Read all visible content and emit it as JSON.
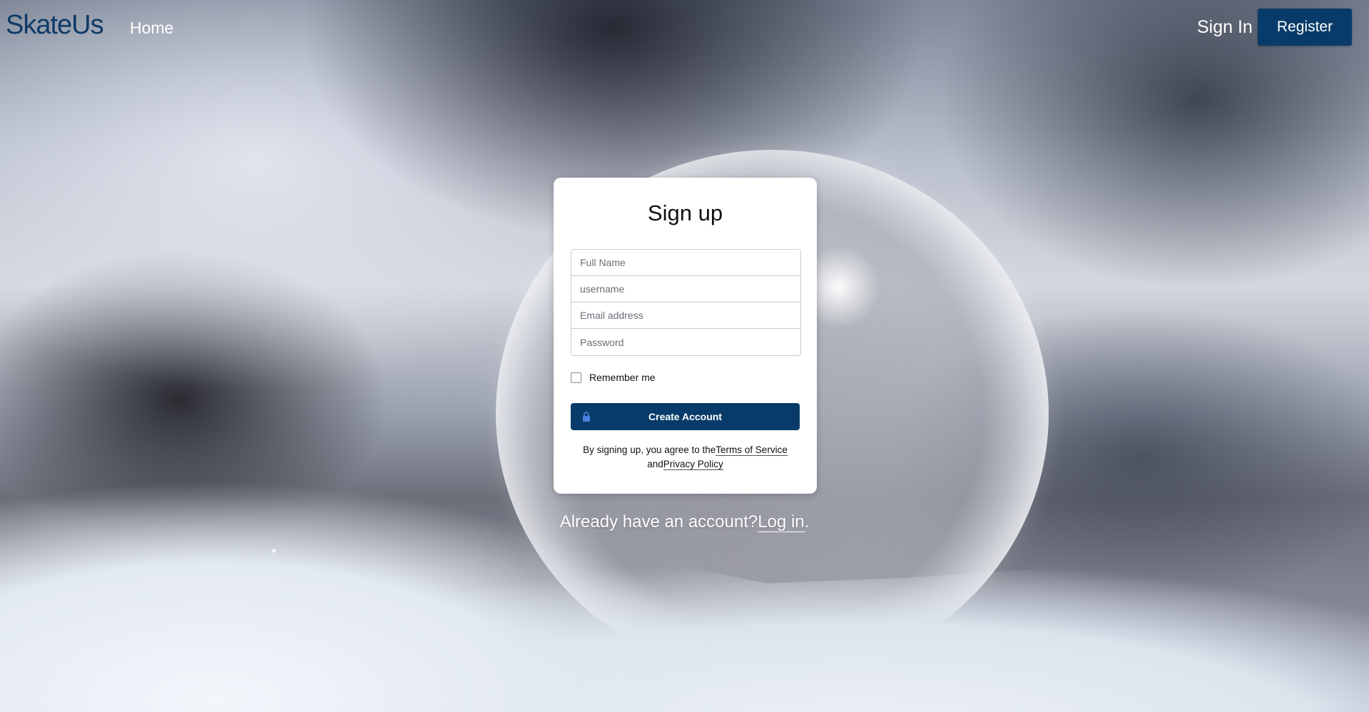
{
  "nav": {
    "brand": "SkateUs",
    "home": "Home",
    "sign_in": "Sign In",
    "register": "Register"
  },
  "signup": {
    "title": "Sign up",
    "fields": {
      "full_name_placeholder": "Full Name",
      "username_placeholder": "username",
      "email_placeholder": "Email address",
      "password_placeholder": "Password"
    },
    "remember_me": "Remember me",
    "create_account": "Create Account",
    "terms_prefix": "By signing up, you agree to the",
    "terms_link": "Terms of Service",
    "terms_and": "and",
    "privacy_link": "Privacy Policy"
  },
  "footer": {
    "already": "Already have an account?",
    "login_link": "Log in",
    "period": "."
  },
  "colors": {
    "brand_blue": "#083b69",
    "card_bg": "#ffffff"
  }
}
